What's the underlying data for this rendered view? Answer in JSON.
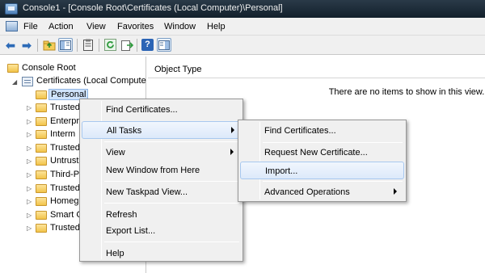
{
  "window": {
    "title": "Console1 - [Console Root\\Certificates (Local Computer)\\Personal]"
  },
  "menubar": {
    "items": [
      "File",
      "Action",
      "View",
      "Favorites",
      "Window",
      "Help"
    ]
  },
  "tree": {
    "root": "Console Root",
    "certificates": "Certificates (Local Compute",
    "children": [
      "Personal",
      "Trusted",
      "Enterpr",
      "Interm",
      "Trusted",
      "Untrust",
      "Third-P",
      "Trusted",
      "Homeg",
      "Smart C",
      "Trusted"
    ]
  },
  "list": {
    "column": "Object Type",
    "empty_message": "There are no items to show in this view."
  },
  "context_menu": {
    "find": "Find Certificates...",
    "all_tasks": "All Tasks",
    "view": "View",
    "new_window": "New Window from Here",
    "taskpad": "New Taskpad View...",
    "refresh": "Refresh",
    "export": "Export List...",
    "help": "Help"
  },
  "submenu": {
    "find": "Find Certificates...",
    "request": "Request New Certificate...",
    "import": "Import...",
    "advanced": "Advanced Operations"
  },
  "icons": [
    "back-arrow-icon",
    "forward-arrow-icon",
    "up-folder-icon",
    "show-tree-icon",
    "properties-icon",
    "refresh-icon",
    "export-icon",
    "help-icon",
    "action-pane-icon"
  ]
}
